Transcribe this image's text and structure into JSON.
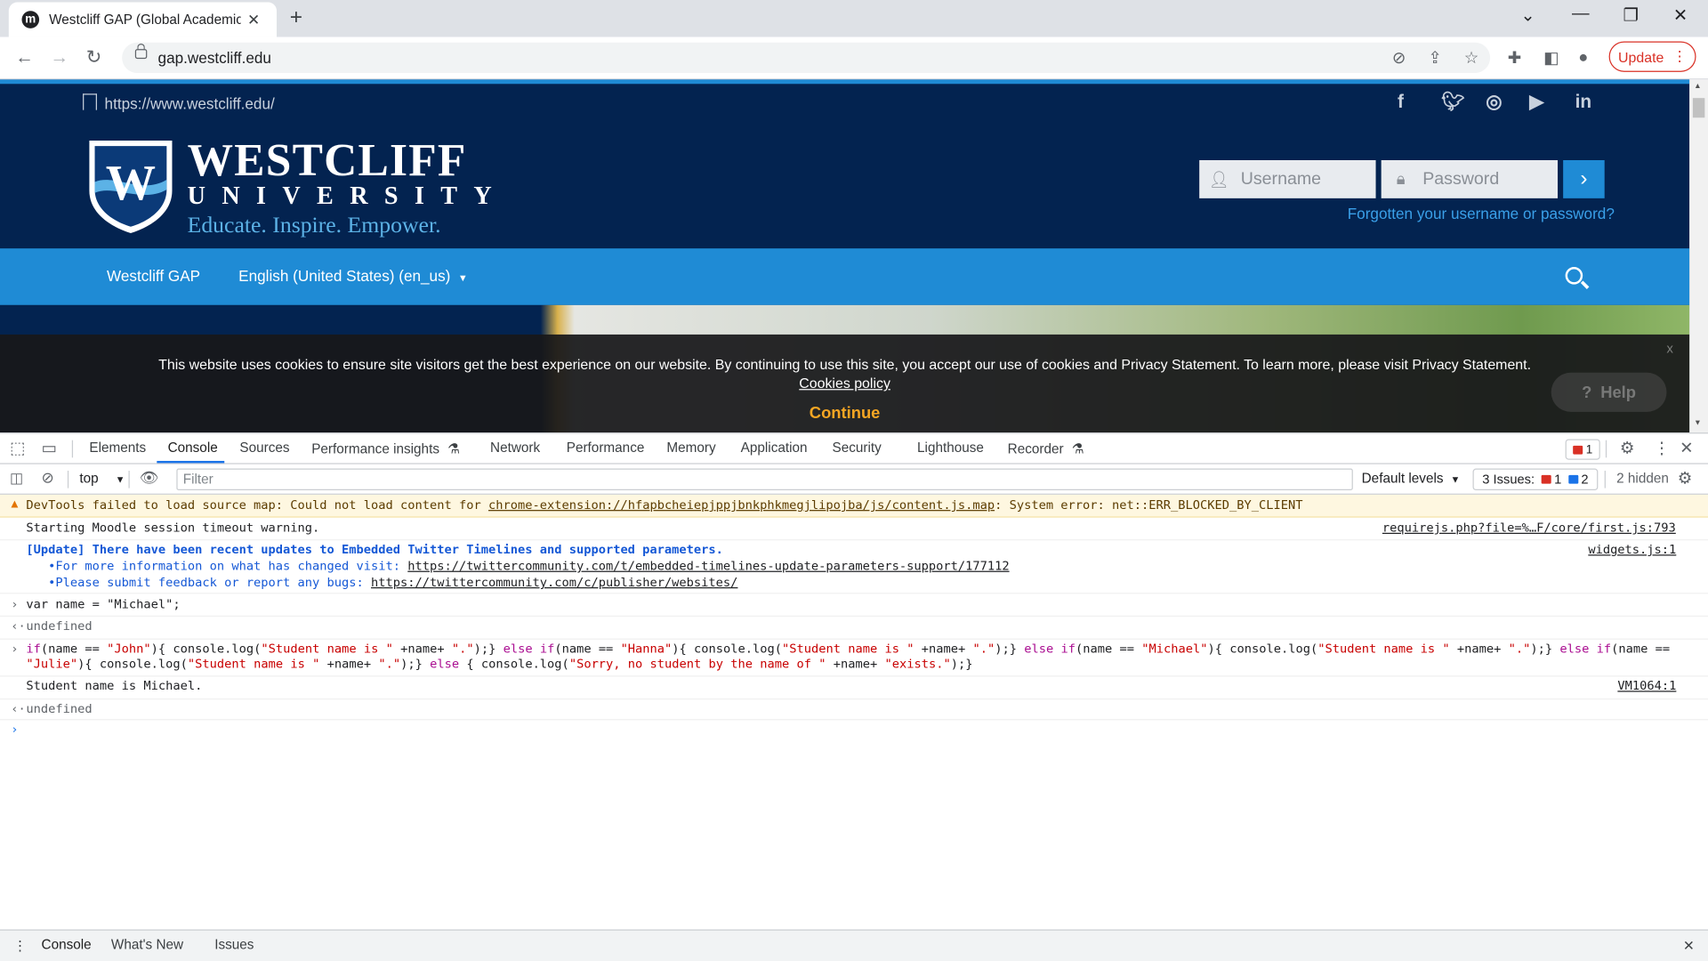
{
  "browser": {
    "tab_title": "Westcliff GAP (Global Academic P",
    "favicon_letter": "m",
    "url": "gap.westcliff.edu",
    "update_label": "Update"
  },
  "site": {
    "top_url": "https://www.westcliff.edu/",
    "brand_line1": "WESTCLIFF",
    "brand_line2": "UNIVERSITY",
    "tagline": "Educate. Inspire. Empower.",
    "username_placeholder": "Username",
    "password_placeholder": "Password",
    "forgot_link": "Forgotten your username or password?",
    "nav_home": "Westcliff GAP",
    "nav_language": "English (United States) (en_us)",
    "cookie_text": "This website uses cookies to ensure site visitors get the best experience on our website. By continuing to use this site, you accept our use of cookies and Privacy Statement. To learn more, please visit Privacy Statement.",
    "cookie_link": "Cookies policy",
    "continue_label": "Continue",
    "help_label": "Help",
    "close_label": "x"
  },
  "devtools": {
    "tabs": [
      "Elements",
      "Console",
      "Sources",
      "Performance insights",
      "Network",
      "Performance",
      "Memory",
      "Application",
      "Security",
      "Lighthouse",
      "Recorder"
    ],
    "error_count": "1",
    "context": "top",
    "filter_placeholder": "Filter",
    "levels": "Default levels",
    "issues_label": "3 Issues:",
    "issues_errors": "1",
    "issues_info": "2",
    "hidden": "2 hidden"
  },
  "console": {
    "warn_prefix": "DevTools failed to load source map: Could not load content for ",
    "warn_link": "chrome-extension://hfapbcheiepjppjbnkphkmegjlipojba/js/content.js.map",
    "warn_suffix": ": System error: net::ERR_BLOCKED_BY_CLIENT",
    "msg1": "Starting Moodle session timeout warning.",
    "msg1_src": "requirejs.php?file=%…F/core/first.js:793",
    "msg2_title": "[Update] There have been recent updates to Embedded Twitter Timelines and supported parameters.",
    "msg2_src": "widgets.js:1",
    "msg2_line2_prefix": "   •For more information on what has changed visit: ",
    "msg2_line2_link": "https://twittercommunity.com/t/embedded-timelines-update-parameters-support/177112",
    "msg2_line3_prefix": "   •Please submit feedback or report any bugs: ",
    "msg2_line3_link": "https://twittercommunity.com/c/publisher/websites/",
    "input1": "var name = \"Michael\";",
    "undefined": "undefined",
    "output_student": "Student name is Michael.",
    "output_src": "VM1064:1"
  },
  "drawer": {
    "tabs": [
      "Console",
      "What's New",
      "Issues"
    ]
  }
}
